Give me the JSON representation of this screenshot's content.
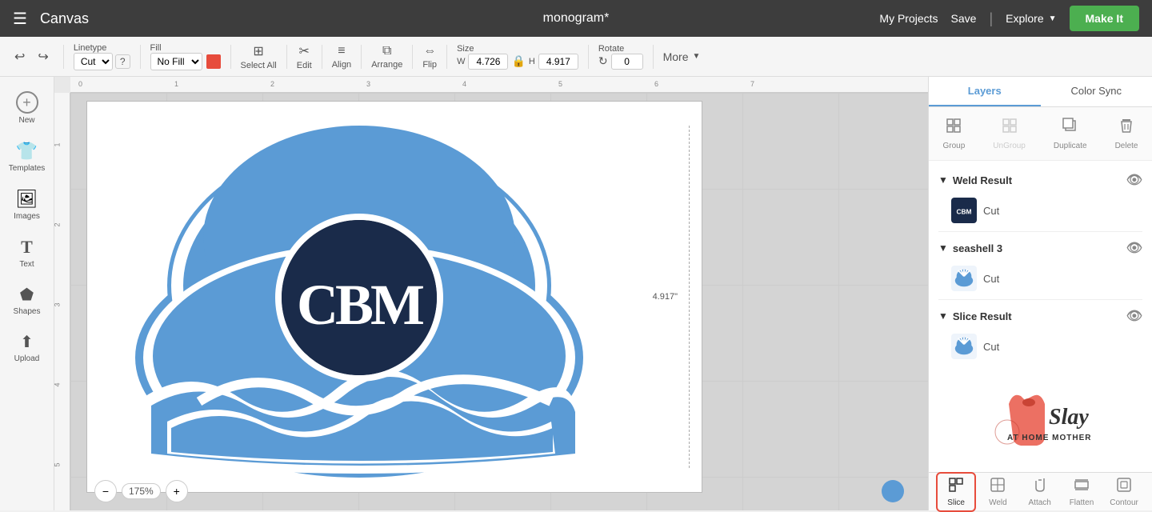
{
  "app": {
    "menu_icon": "☰",
    "title": "Canvas",
    "project_name": "monogram*"
  },
  "top_bar": {
    "my_projects": "My Projects",
    "save": "Save",
    "divider": "|",
    "explore": "Explore",
    "make_it": "Make It"
  },
  "toolbar": {
    "undo": "↩",
    "redo": "↪",
    "linetype_label": "Linetype",
    "linetype_value": "Cut",
    "linetype_q": "?",
    "fill_label": "Fill",
    "fill_value": "No Fill",
    "select_all_label": "Select All",
    "edit_label": "Edit",
    "align_label": "Align",
    "arrange_label": "Arrange",
    "flip_label": "Flip",
    "size_label": "Size",
    "width_label": "W",
    "width_value": "4.726",
    "height_label": "H",
    "height_value": "4.917",
    "rotate_label": "Rotate",
    "rotate_value": "0",
    "more_label": "More"
  },
  "left_sidebar": {
    "items": [
      {
        "icon": "+",
        "label": "New",
        "name": "new"
      },
      {
        "icon": "👕",
        "label": "Templates",
        "name": "templates"
      },
      {
        "icon": "🖼",
        "label": "Images",
        "name": "images"
      },
      {
        "icon": "T",
        "label": "Text",
        "name": "text"
      },
      {
        "icon": "⬟",
        "label": "Shapes",
        "name": "shapes"
      },
      {
        "icon": "⬆",
        "label": "Upload",
        "name": "upload"
      }
    ]
  },
  "canvas": {
    "zoom": "175%",
    "measurement": "4.917\""
  },
  "right_panel": {
    "tabs": [
      "Layers",
      "Color Sync"
    ],
    "active_tab": "Layers"
  },
  "panel_tools": {
    "group": "Group",
    "ungroup": "UnGroup",
    "duplicate": "Duplicate",
    "delete": "Delete"
  },
  "layers": [
    {
      "group_name": "Weld Result",
      "expanded": true,
      "visible": true,
      "items": [
        {
          "label": "Cut",
          "has_thumb": true,
          "thumb_type": "monogram"
        }
      ]
    },
    {
      "group_name": "seashell 3",
      "expanded": true,
      "visible": true,
      "items": [
        {
          "label": "Cut",
          "has_thumb": true,
          "thumb_type": "seashell-blue"
        }
      ]
    },
    {
      "group_name": "Slice Result",
      "expanded": true,
      "visible": true,
      "items": [
        {
          "label": "Cut",
          "has_thumb": true,
          "thumb_type": "seashell-blue"
        }
      ]
    }
  ],
  "bottom_tools": [
    {
      "label": "Slice",
      "icon": "⊟",
      "active": true,
      "name": "slice"
    },
    {
      "label": "Weld",
      "icon": "⊞",
      "active": false,
      "name": "weld"
    },
    {
      "label": "Attach",
      "icon": "📎",
      "active": false,
      "name": "attach"
    },
    {
      "label": "Flatten",
      "icon": "⬛",
      "active": false,
      "name": "flatten"
    },
    {
      "label": "Contour",
      "icon": "◻",
      "active": false,
      "name": "contour"
    }
  ],
  "watermark": {
    "line1": "Slay",
    "line2": "AT HOME MOTHER"
  },
  "ruler_marks": [
    "0",
    "1",
    "2",
    "3",
    "4",
    "5",
    "6",
    "7"
  ],
  "v_ruler_marks": [
    "1",
    "2",
    "3",
    "4",
    "5"
  ]
}
